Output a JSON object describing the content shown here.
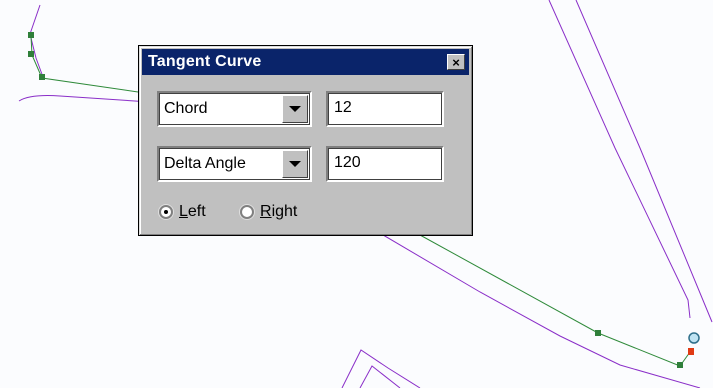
{
  "dialog": {
    "title": "Tangent Curve",
    "close_glyph": "×",
    "row1": {
      "type_selected": "Chord",
      "value": "12"
    },
    "row2": {
      "type_selected": "Delta Angle",
      "value": "120"
    },
    "direction": {
      "left_prefix": "",
      "left_mnemonic": "L",
      "left_suffix": "eft",
      "right_mnemonic": "R",
      "right_suffix": "ight",
      "selected": "Left"
    }
  },
  "colors": {
    "parcel_line": "#8a2ec8",
    "sketch_line": "#2f8a3a",
    "vertex": "#2f7f3a",
    "current_vertex": "#e03a14",
    "snap_marker": "#5aa6c8",
    "titlebar": "#0a246a",
    "dialog_face": "#c0c0c0"
  }
}
